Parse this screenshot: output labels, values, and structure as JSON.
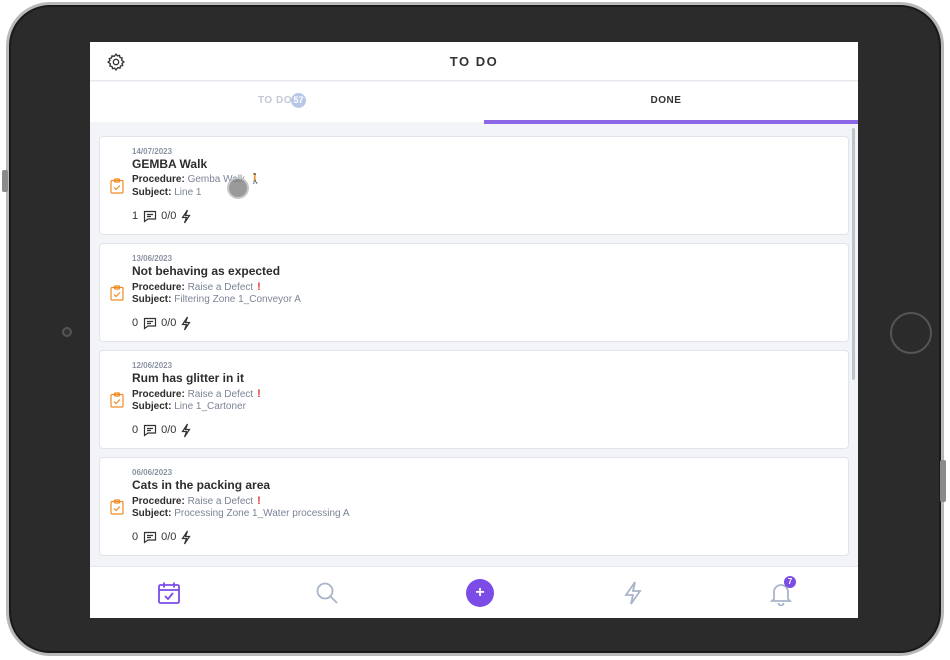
{
  "header": {
    "title": "TO DO"
  },
  "tabs": [
    {
      "label": "TO DO",
      "badge": "57",
      "active": false
    },
    {
      "label": "DONE",
      "active": true
    }
  ],
  "labels": {
    "procedure": "Procedure:",
    "subject": "Subject:"
  },
  "cards": [
    {
      "date": "14/07/2023",
      "title": "GEMBA Walk",
      "procedure": "Gemba Walk",
      "subject": "Line 1",
      "comments": "1",
      "actions": "0/0",
      "marker": "walk"
    },
    {
      "date": "13/06/2023",
      "title": "Not behaving as expected",
      "procedure": "Raise a Defect",
      "subject": "Filtering Zone 1_Conveyor A",
      "comments": "0",
      "actions": "0/0",
      "marker": "exclamation"
    },
    {
      "date": "12/06/2023",
      "title": "Rum has glitter in it",
      "procedure": "Raise a Defect",
      "subject": "Line 1_Cartoner",
      "comments": "0",
      "actions": "0/0",
      "marker": "exclamation"
    },
    {
      "date": "06/06/2023",
      "title": "Cats in the packing area",
      "procedure": "Raise a Defect",
      "subject": "Processing Zone 1_Water processing A",
      "comments": "0",
      "actions": "0/0",
      "marker": "exclamation"
    }
  ],
  "bottom_nav": {
    "items": [
      "calendar-icon",
      "search-icon",
      "add-icon",
      "bolt-icon",
      "bell-icon"
    ],
    "add_label": "+",
    "notifications": "7"
  },
  "colors": {
    "accent": "#7b4ce6",
    "tab_indicator": "#8b67e6",
    "clipboard": "#f08a24",
    "alert": "#e53935"
  }
}
